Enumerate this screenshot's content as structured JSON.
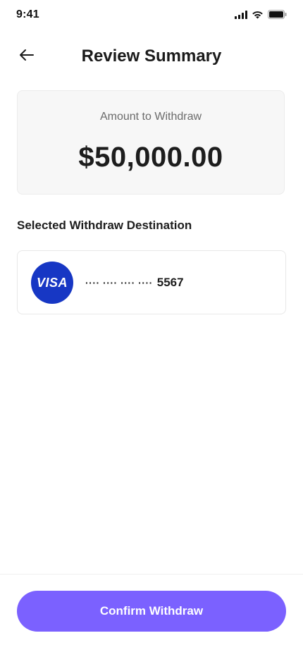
{
  "status_bar": {
    "time": "9:41",
    "signal_icon": "cellular-signal-icon",
    "wifi_icon": "wifi-icon",
    "battery_icon": "battery-icon"
  },
  "header": {
    "back_icon": "arrow-left-icon",
    "title": "Review Summary"
  },
  "amount": {
    "label": "Amount to Withdraw",
    "value": "$50,000.00"
  },
  "destination": {
    "section_title": "Selected Withdraw Destination",
    "card_brand": "VISA",
    "card_mask": "···· ···· ···· ····",
    "card_last4": "5567",
    "brand_color": "#1737c4"
  },
  "footer": {
    "confirm_label": "Confirm Withdraw",
    "accent_color": "#7b61ff"
  }
}
